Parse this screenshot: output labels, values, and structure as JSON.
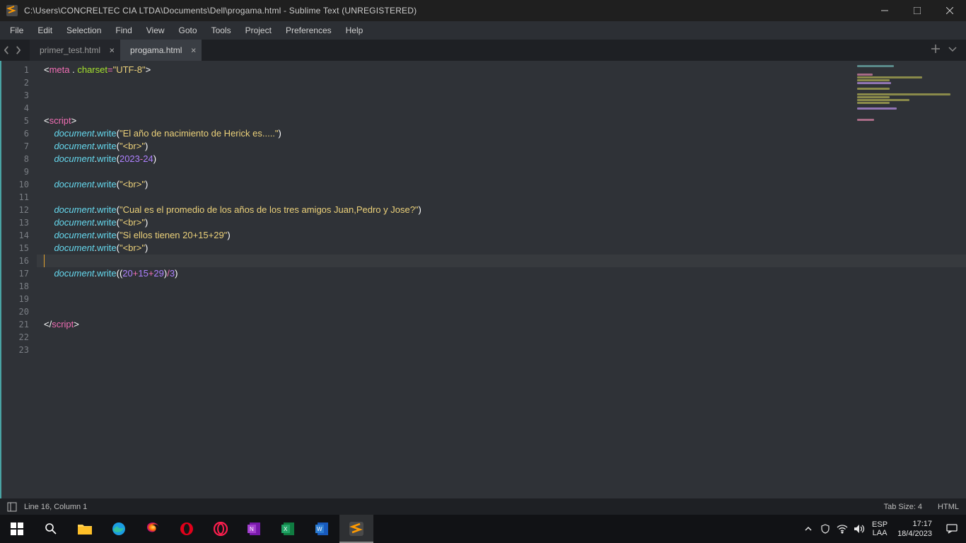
{
  "titlebar": {
    "title": "C:\\Users\\CONCRELTEC CIA LTDA\\Documents\\Dell\\progama.html - Sublime Text (UNREGISTERED)"
  },
  "menu": [
    "File",
    "Edit",
    "Selection",
    "Find",
    "View",
    "Goto",
    "Tools",
    "Project",
    "Preferences",
    "Help"
  ],
  "tabs": {
    "left": "primer_test.html",
    "active": "progama.html"
  },
  "status": {
    "pos": "Line 16, Column 1",
    "tabsize": "Tab Size: 4",
    "lang": "HTML"
  },
  "tray": {
    "kbd": "ESP",
    "kbd2": "LAA",
    "time": "17:17",
    "date": "18/4/2023"
  },
  "gutter_count": 23,
  "code": {
    "l1": {
      "a": "<",
      "b": "meta",
      "c": " . ",
      "d": "charset",
      "e": "=",
      "f": "\"UTF-8\"",
      "g": ">"
    },
    "l5": {
      "a": "<",
      "b": "script",
      "c": ">"
    },
    "l6": {
      "ind": "    ",
      "obj": "document",
      "dot": ".",
      "m": "write",
      "op": "(",
      "s": "\"El año de nacimiento de Herick es.....\"",
      "cp": ")"
    },
    "l7": {
      "ind": "    ",
      "obj": "document",
      "dot": ".",
      "m": "write",
      "op": "(",
      "s": "\"<br>\"",
      "cp": ")"
    },
    "l8": {
      "ind": "    ",
      "obj": "document",
      "dot": ".",
      "m": "write",
      "op": "(",
      "n1": "2023",
      "minus": "-",
      "n2": "24",
      "cp": ")"
    },
    "l10": {
      "ind": "    ",
      "obj": "document",
      "dot": ".",
      "m": "write",
      "op": "(",
      "s": "\"<br>\"",
      "cp": ")"
    },
    "l12": {
      "ind": "    ",
      "obj": "document",
      "dot": ".",
      "m": "write",
      "op": "(",
      "s": "\"Cual es el promedio de los años de los tres amigos Juan,Pedro y Jose?\"",
      "cp": ")"
    },
    "l13": {
      "ind": "    ",
      "obj": "document",
      "dot": ".",
      "m": "write",
      "op": "(",
      "s": "\"<br>\"",
      "cp": ")"
    },
    "l14": {
      "ind": "    ",
      "obj": "document",
      "dot": ".",
      "m": "write",
      "op": "(",
      "s": "\"Si ellos tienen 20+15+29\"",
      "cp": ")"
    },
    "l15": {
      "ind": "    ",
      "obj": "document",
      "dot": ".",
      "m": "write",
      "op": "(",
      "s": "\"<br>\"",
      "cp": ")"
    },
    "l17": {
      "ind": "    ",
      "obj": "document",
      "dot": ".",
      "m": "write",
      "op": "((",
      "n1": "20",
      "p1": "+",
      "n2": "15",
      "p2": "+",
      "n3": "29",
      "cp1": ")",
      "div": "/",
      "n4": "3",
      "cp2": ")"
    },
    "l21": {
      "a": "</",
      "b": "script",
      "c": ">"
    }
  }
}
